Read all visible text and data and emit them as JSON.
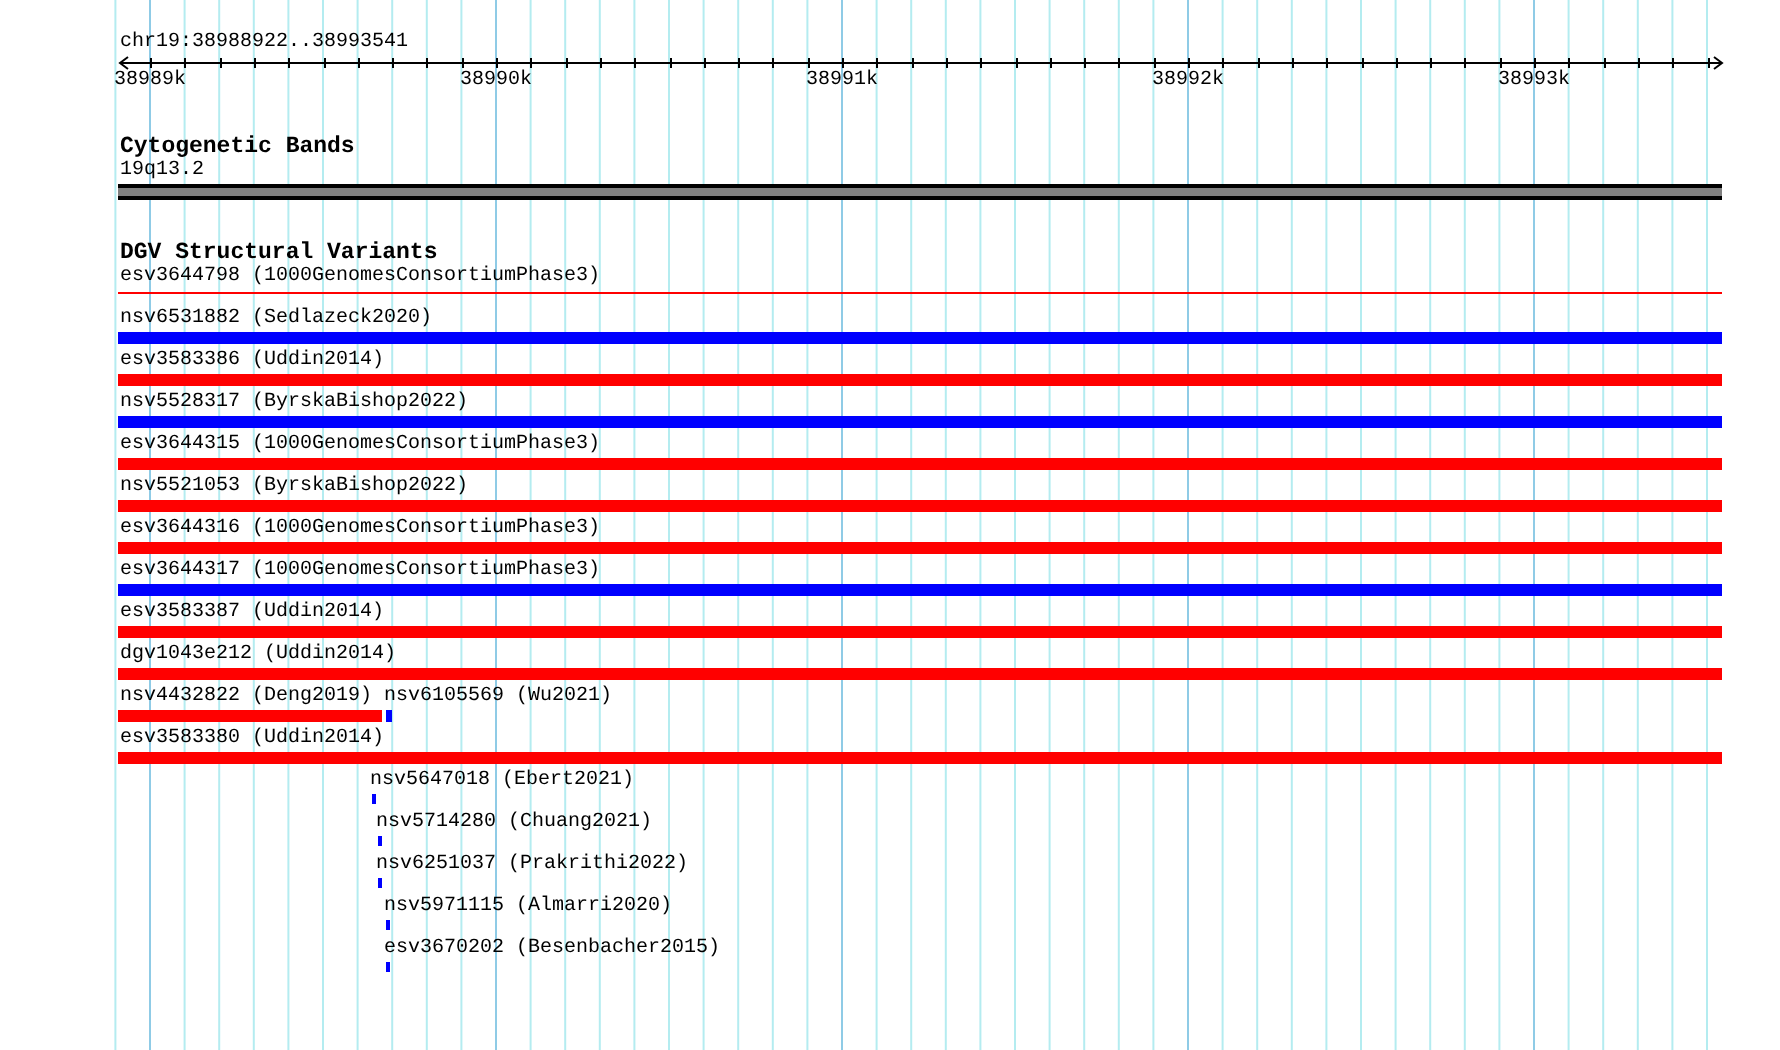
{
  "ruler": {
    "location": "chr19:38988922..38993541",
    "ticks": [
      "38989k",
      "38990k",
      "38991k",
      "38992k",
      "38993k"
    ]
  },
  "cytogenetic_bands": {
    "title": "Cytogenetic Bands",
    "band_label": "19q13.2"
  },
  "dgv_track": {
    "title": "DGV Structural Variants",
    "rows": [
      {
        "features": [
          {
            "label": "esv3644798 (1000GenomesConsortiumPhase3)",
            "color": "#ff0000"
          }
        ]
      },
      {
        "features": [
          {
            "label": "nsv6531882 (Sedlazeck2020)",
            "color": "#0000ff"
          }
        ]
      },
      {
        "features": [
          {
            "label": "esv3583386 (Uddin2014)",
            "color": "#ff0000"
          }
        ]
      },
      {
        "features": [
          {
            "label": "nsv5528317 (ByrskaBishop2022)",
            "color": "#0000ff"
          }
        ]
      },
      {
        "features": [
          {
            "label": "esv3644315 (1000GenomesConsortiumPhase3)",
            "color": "#ff0000"
          }
        ]
      },
      {
        "features": [
          {
            "label": "nsv5521053 (ByrskaBishop2022)",
            "color": "#ff0000"
          }
        ]
      },
      {
        "features": [
          {
            "label": "esv3644316 (1000GenomesConsortiumPhase3)",
            "color": "#ff0000"
          }
        ]
      },
      {
        "features": [
          {
            "label": "esv3644317 (1000GenomesConsortiumPhase3)",
            "color": "#0000ff"
          }
        ]
      },
      {
        "features": [
          {
            "label": "esv3583387 (Uddin2014)",
            "color": "#ff0000"
          }
        ]
      },
      {
        "features": [
          {
            "label": "dgv1043e212 (Uddin2014)",
            "color": "#ff0000"
          }
        ]
      },
      {
        "features": [
          {
            "label": "nsv4432822 (Deng2019)",
            "color": "#ff0000"
          },
          {
            "label": "nsv6105569 (Wu2021)",
            "color": "#0000ff"
          }
        ]
      },
      {
        "features": [
          {
            "label": "esv3583380 (Uddin2014)",
            "color": "#ff0000"
          }
        ]
      },
      {
        "features": [
          {
            "label": "nsv5647018 (Ebert2021)",
            "color": "#0000ff"
          }
        ]
      },
      {
        "features": [
          {
            "label": "nsv5714280 (Chuang2021)",
            "color": "#0000ff"
          }
        ]
      },
      {
        "features": [
          {
            "label": "nsv6251037 (Prakrithi2022)",
            "color": "#0000ff"
          }
        ]
      },
      {
        "features": [
          {
            "label": "nsv5971115 (Almarri2020)",
            "color": "#0000ff"
          }
        ]
      },
      {
        "features": [
          {
            "label": "esv3670202 (Besenbacher2015)",
            "color": "#0000ff"
          }
        ]
      }
    ]
  }
}
